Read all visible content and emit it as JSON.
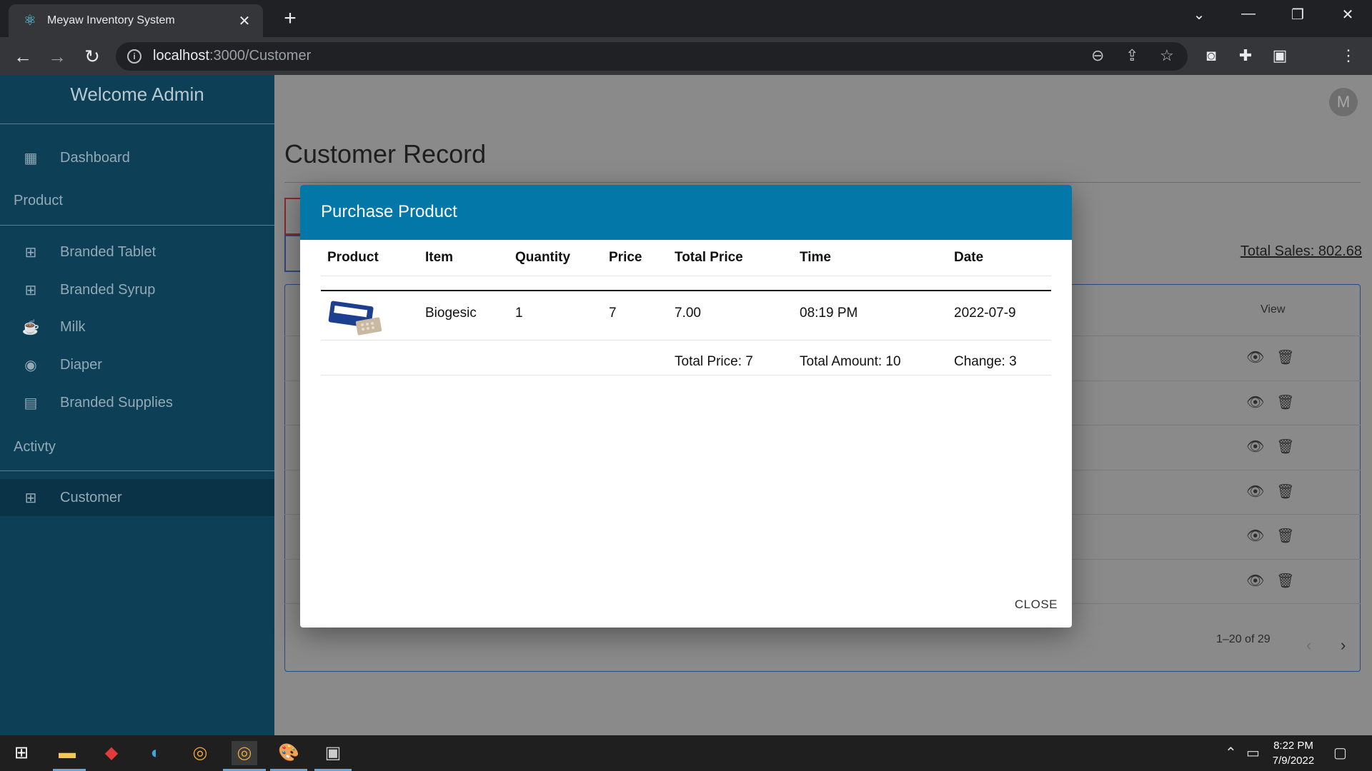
{
  "browser": {
    "tab_title": "Meyaw Inventory System",
    "tab_close": "✕",
    "new_tab": "+",
    "url_host": "localhost",
    "url_rest": ":3000/Customer",
    "info": "i"
  },
  "sidebar": {
    "title": "Welcome Admin",
    "dashboard": "Dashboard",
    "product_heading": "Product",
    "items": [
      {
        "label": "Branded Tablet",
        "icon": "medkit-icon"
      },
      {
        "label": "Branded Syrup",
        "icon": "medkit-icon"
      },
      {
        "label": "Milk",
        "icon": "cup-icon"
      },
      {
        "label": "Diaper",
        "icon": "eye-icon"
      },
      {
        "label": "Branded Supplies",
        "icon": "archive-icon"
      }
    ],
    "activity_heading": "Activty",
    "customer": "Customer"
  },
  "main": {
    "avatar_letter": "M",
    "page_title": "Customer Record",
    "total_sales": "Total Sales: 802.68",
    "view_header": "View",
    "pagination": "1–20 of 29"
  },
  "modal": {
    "title": "Purchase Product",
    "headers": [
      "Product",
      "Item",
      "Quantity",
      "Price",
      "Total Price",
      "Time",
      "Date"
    ],
    "row": {
      "item": "Biogesic",
      "quantity": "1",
      "price": "7",
      "total_price": "7.00",
      "time": "08:19 PM",
      "date": "2022-07-9"
    },
    "footer": {
      "total_price": "Total Price: 7",
      "total_amount": "Total Amount: 10",
      "change": "Change: 3"
    },
    "close": "CLOSE"
  },
  "taskbar": {
    "time": "8:22 PM",
    "date": "7/9/2022"
  }
}
